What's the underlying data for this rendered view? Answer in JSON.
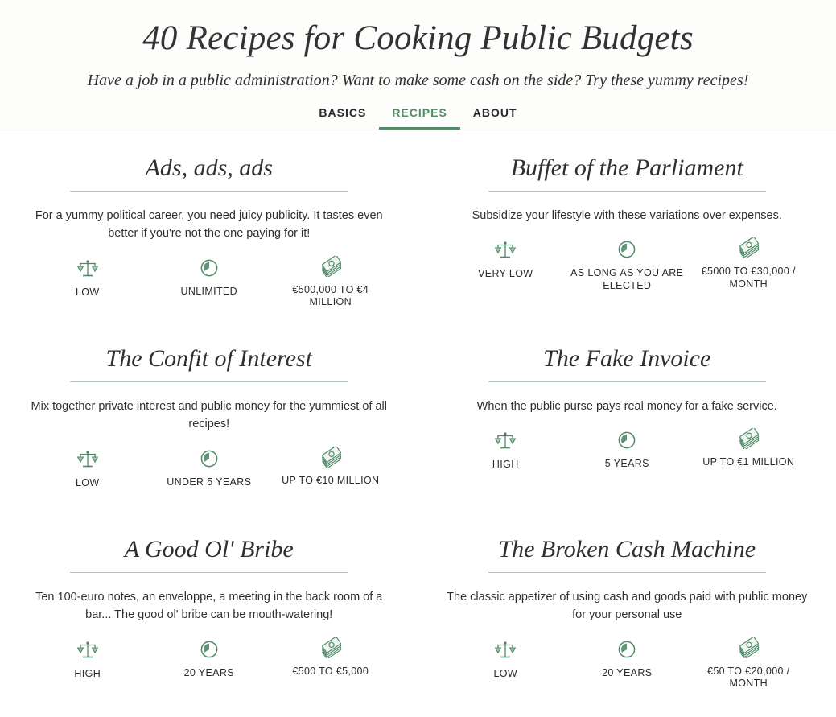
{
  "header": {
    "title": "40 Recipes for Cooking Public Budgets",
    "subtitle": "Have a job in a public administration? Want to make some cash on the side? Try these yummy recipes!"
  },
  "nav": {
    "items": [
      {
        "label": "BASICS",
        "active": false
      },
      {
        "label": "RECIPES",
        "active": true
      },
      {
        "label": "ABOUT",
        "active": false
      }
    ]
  },
  "colors": {
    "accent_green": "#548a68",
    "icon_green": "#4f8a66",
    "rule_green": "#a8c6b2",
    "text_dark": "#2e2e2e",
    "header_bg": "#fdfdfc",
    "page_bg": "#ffffff"
  },
  "stat_icons": [
    "scales-icon",
    "clock-icon",
    "banknotes-icon"
  ],
  "recipes": [
    {
      "title": "Ads, ads, ads",
      "description": "For a yummy political career, you need juicy publicity. It tastes even better if you're not the one paying for it!",
      "stats": [
        {
          "icon": "scales-icon",
          "label": "LOW"
        },
        {
          "icon": "clock-icon",
          "label": "UNLIMITED"
        },
        {
          "icon": "banknotes-icon",
          "label": "€500,000 TO €4 MILLION"
        }
      ]
    },
    {
      "title": "Buffet of the Parliament",
      "description": "Subsidize your lifestyle with these variations over expenses.",
      "stats": [
        {
          "icon": "scales-icon",
          "label": "VERY LOW"
        },
        {
          "icon": "clock-icon",
          "label": "AS LONG AS YOU ARE ELECTED"
        },
        {
          "icon": "banknotes-icon",
          "label": "€5000 TO €30,000 / MONTH"
        }
      ]
    },
    {
      "title": "The Confit of Interest",
      "description": "Mix together private interest and public money for the yummiest of all recipes!",
      "stats": [
        {
          "icon": "scales-icon",
          "label": "LOW"
        },
        {
          "icon": "clock-icon",
          "label": "UNDER 5 YEARS"
        },
        {
          "icon": "banknotes-icon",
          "label": "UP TO €10 MILLION"
        }
      ]
    },
    {
      "title": "The Fake Invoice",
      "description": "When the public purse pays real money for a fake service.",
      "stats": [
        {
          "icon": "scales-icon",
          "label": "HIGH"
        },
        {
          "icon": "clock-icon",
          "label": "5 YEARS"
        },
        {
          "icon": "banknotes-icon",
          "label": "UP TO €1 MILLION"
        }
      ]
    },
    {
      "title": "A Good Ol' Bribe",
      "description": "Ten 100-euro notes, an enveloppe, a meeting in the back room of a bar... The good ol' bribe can be mouth-watering!",
      "stats": [
        {
          "icon": "scales-icon",
          "label": "HIGH"
        },
        {
          "icon": "clock-icon",
          "label": "20 YEARS"
        },
        {
          "icon": "banknotes-icon",
          "label": "€500 TO €5,000"
        }
      ]
    },
    {
      "title": "The Broken Cash Machine",
      "description": "The classic appetizer of using cash and goods paid with public money for your personal use",
      "stats": [
        {
          "icon": "scales-icon",
          "label": "LOW"
        },
        {
          "icon": "clock-icon",
          "label": "20 YEARS"
        },
        {
          "icon": "banknotes-icon",
          "label": "€50 TO €20,000 / MONTH"
        }
      ]
    }
  ]
}
